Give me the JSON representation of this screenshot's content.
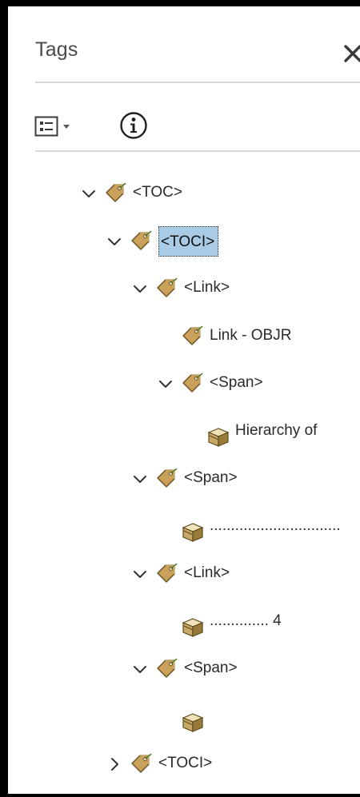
{
  "panel": {
    "title": "Tags"
  },
  "tree": [
    {
      "label": "<TOC>",
      "depth": 0,
      "expanded": true,
      "icon": "tag-icon",
      "selected": false
    },
    {
      "label": "<TOCI>",
      "depth": 1,
      "expanded": true,
      "icon": "tag-icon",
      "selected": true
    },
    {
      "label": "<Link>",
      "depth": 2,
      "expanded": true,
      "icon": "tag-icon",
      "selected": false
    },
    {
      "label": "Link - OBJR",
      "depth": 3,
      "expanded": null,
      "icon": "tag-icon",
      "selected": false
    },
    {
      "label": "<Span>",
      "depth": 3,
      "expanded": true,
      "icon": "tag-icon",
      "selected": false
    },
    {
      "label": "Hierarchy of",
      "depth": 4,
      "expanded": null,
      "icon": "content-box-icon",
      "selected": false
    },
    {
      "label": "<Span>",
      "depth": 2,
      "expanded": true,
      "icon": "tag-icon",
      "selected": false
    },
    {
      "label": "...............................",
      "depth": 3,
      "expanded": null,
      "icon": "content-box-icon",
      "selected": false
    },
    {
      "label": "<Link>",
      "depth": 2,
      "expanded": true,
      "icon": "tag-icon",
      "selected": false
    },
    {
      "label": ".............. 4",
      "depth": 3,
      "expanded": null,
      "icon": "content-box-icon",
      "selected": false
    },
    {
      "label": "<Span>",
      "depth": 2,
      "expanded": true,
      "icon": "tag-icon",
      "selected": false
    },
    {
      "label": "",
      "depth": 3,
      "expanded": null,
      "icon": "content-box-icon",
      "selected": false
    },
    {
      "label": "<TOCI>",
      "depth": 1,
      "expanded": false,
      "icon": "tag-icon",
      "selected": false
    }
  ],
  "colors": {
    "selection": "#a9cbe6",
    "tag": "#c9a15a",
    "divider": "#d6d6d6"
  }
}
